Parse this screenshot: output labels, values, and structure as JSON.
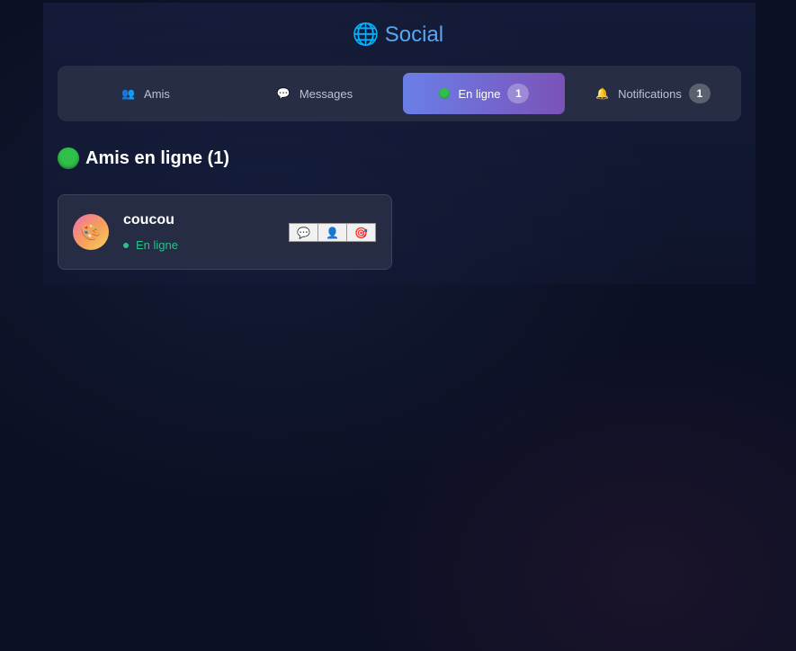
{
  "header": {
    "icon": "globe-icon",
    "title": "Social"
  },
  "tabs": [
    {
      "label": "Amis",
      "icon": "friends-icon",
      "count": null,
      "active": false
    },
    {
      "label": "Messages",
      "icon": "speech-bubble-icon",
      "count": null,
      "active": false
    },
    {
      "label": "En ligne",
      "icon": "green-dot-icon",
      "count": "1",
      "active": true
    },
    {
      "label": "Notifications",
      "icon": "bell-icon",
      "count": "1",
      "active": false
    }
  ],
  "section": {
    "title": "Amis en ligne (1)",
    "icon": "green-dot-icon"
  },
  "friends": [
    {
      "name": "coucou",
      "avatar_icon": "palette-icon",
      "status": "En ligne",
      "actions": [
        "message-icon",
        "profile-icon",
        "target-icon"
      ]
    }
  ],
  "colors": {
    "accent_title": "#5aa6ee",
    "tab_active_start": "#6a7fe8",
    "tab_active_end": "#7b52b8",
    "online_green": "#28c28d",
    "background": "#0c1024"
  }
}
